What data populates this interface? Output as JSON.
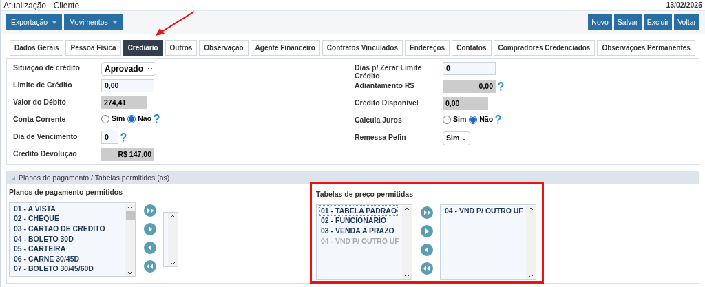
{
  "window": {
    "title": "Atualização - Cliente",
    "date": "13/02/2025"
  },
  "menus": [
    {
      "label": "Exportação"
    },
    {
      "label": "Movimentos"
    }
  ],
  "actions": [
    "Novo",
    "Salvar",
    "Excluir",
    "Voltar"
  ],
  "tabs": [
    {
      "label": "Dados Gerais",
      "selected": false
    },
    {
      "label": "Pessoa Física",
      "selected": false
    },
    {
      "label": "Crediário",
      "selected": true
    },
    {
      "label": "Outros",
      "selected": false
    },
    {
      "label": "Observação",
      "selected": false
    },
    {
      "label": "Agente Financeiro",
      "selected": false
    },
    {
      "label": "Contratos Vinculados",
      "selected": false
    },
    {
      "label": "Endereços",
      "selected": false
    },
    {
      "label": "Contatos",
      "selected": false
    },
    {
      "label": "Compradores Credenciados",
      "selected": false
    },
    {
      "label": "Observações Permanentes",
      "selected": false
    }
  ],
  "form_left": [
    {
      "label": "Situação de crédito",
      "kind": "select",
      "value": "Aprovado",
      "help": false
    },
    {
      "label": "Limite de Crédito",
      "kind": "input",
      "value": "0,00",
      "help": false
    },
    {
      "label": "Valor do Débito",
      "kind": "readonly",
      "value": "274,41",
      "help": false
    },
    {
      "label": "Conta Corrente",
      "kind": "radio",
      "options": [
        {
          "label": "Sim",
          "selected": false
        },
        {
          "label": "Não",
          "selected": true
        }
      ],
      "help": true
    },
    {
      "label": "Dia de Vencimento",
      "kind": "small_input",
      "value": "0",
      "help": true
    },
    {
      "label": "Credito Devolução",
      "kind": "readonly_right",
      "value": "R$ 147,00",
      "help": false
    }
  ],
  "form_right": [
    {
      "label": "Dias p/ Zerar Limite Crédito",
      "kind": "input",
      "value": "0",
      "help": false
    },
    {
      "label": "Adiantamento R$",
      "kind": "readonly_right",
      "value": "0,00",
      "help": true
    },
    {
      "label": "Crédito Disponível",
      "kind": "readonly",
      "value": "0,00",
      "help": false
    },
    {
      "label": "Calcula Juros",
      "kind": "radio",
      "options": [
        {
          "label": "Sim",
          "selected": false
        },
        {
          "label": "Não",
          "selected": true
        }
      ],
      "help": true
    },
    {
      "label": "Remessa Pefin",
      "kind": "small_select",
      "value": "Sim",
      "help": false
    }
  ],
  "section": {
    "title": "Planos de pagamento / Tabelas permitidos (as)",
    "expanded": true
  },
  "payment_plans": {
    "title": "Planos de pagamento permitidos",
    "available": [
      {
        "label": "01 - A VISTA",
        "disabled": false,
        "focused": false
      },
      {
        "label": "02 - CHEQUE",
        "disabled": false,
        "focused": false
      },
      {
        "label": "03 - CARTAO DE CREDITO",
        "disabled": false,
        "focused": false
      },
      {
        "label": "04 - BOLETO 30D",
        "disabled": false,
        "focused": false
      },
      {
        "label": "05 - CARTEIRA",
        "disabled": false,
        "focused": false
      },
      {
        "label": "06 - CARNE 30/45D",
        "disabled": false,
        "focused": false
      },
      {
        "label": "07 - BOLETO 30/45/60D",
        "disabled": false,
        "focused": false
      }
    ]
  },
  "price_tables": {
    "title": "Tabelas de preço permitidas",
    "highlighted": true,
    "available": [
      {
        "label": "01 - TABELA PADRAO",
        "disabled": false,
        "focused": true
      },
      {
        "label": "02 - FUNCIONARIO",
        "disabled": false,
        "focused": false
      },
      {
        "label": "03 - VENDA A PRAZO",
        "disabled": false,
        "focused": false
      },
      {
        "label": "04 - VND P/ OUTRO UF",
        "disabled": true,
        "focused": false
      }
    ],
    "chosen": [
      {
        "label": "04 - VND P/ OUTRO UF",
        "disabled": false,
        "focused": false
      }
    ]
  }
}
